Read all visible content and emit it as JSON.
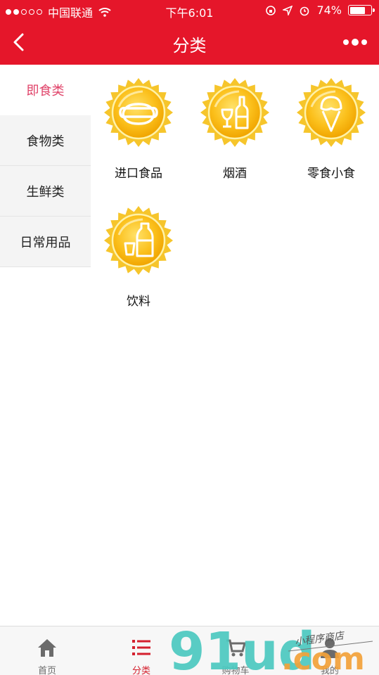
{
  "status_bar": {
    "carrier": "中国联通",
    "time": "下午6:01",
    "battery": "74%",
    "battery_level": 0.74
  },
  "header": {
    "title": "分类",
    "back_icon": "chevron-left-icon",
    "more_icon": "more-dots-icon"
  },
  "sidebar": {
    "items": [
      {
        "label": "即食类",
        "active": true
      },
      {
        "label": "食物类",
        "active": false
      },
      {
        "label": "生鲜类",
        "active": false
      },
      {
        "label": "日常用品",
        "active": false
      }
    ]
  },
  "categories": [
    {
      "label": "进口食品",
      "icon": "hotdog-icon"
    },
    {
      "label": "烟酒",
      "icon": "wine-bottle-icon"
    },
    {
      "label": "零食小食",
      "icon": "ice-cream-icon"
    },
    {
      "label": "饮料",
      "icon": "drink-bottle-icon"
    }
  ],
  "tabbar": {
    "items": [
      {
        "label": "首页",
        "icon": "home-icon",
        "active": false
      },
      {
        "label": "分类",
        "icon": "list-icon",
        "active": true
      },
      {
        "label": "购物车",
        "icon": "cart-icon",
        "active": false
      },
      {
        "label": "我的",
        "icon": "user-icon",
        "active": false
      }
    ]
  },
  "watermark": {
    "brand": "91ud",
    "domain": ".com",
    "tagline": "小程序商店"
  },
  "colors": {
    "header_red": "#e5162a",
    "active_pink": "#e0446a",
    "badge_gold": "#f5b800",
    "tab_active": "#d4202e"
  }
}
